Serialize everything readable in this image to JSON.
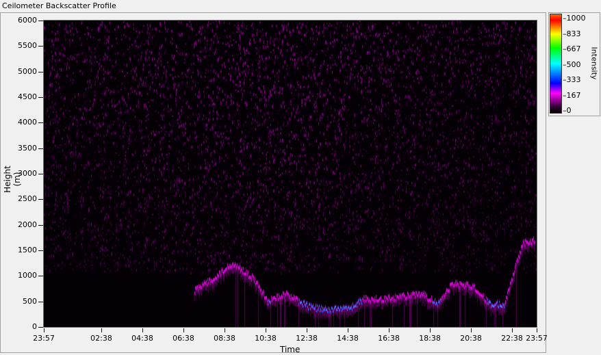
{
  "window_title": "Ceilometer Backscatter Profile",
  "chart_data": {
    "type": "heatmap",
    "title": "Ceilometer Backscatter Profile",
    "xlabel": "Time",
    "ylabel": "Height (m)",
    "ylim": [
      0,
      6000
    ],
    "x_ticks": [
      "23:57",
      "02:38",
      "04:38",
      "06:38",
      "08:38",
      "10:38",
      "12:38",
      "14:38",
      "16:38",
      "18:38",
      "20:38",
      "22:38",
      "23:57"
    ],
    "y_ticks": [
      "0",
      "500",
      "1000",
      "1500",
      "2000",
      "2500",
      "3000",
      "3500",
      "4000",
      "4500",
      "5000",
      "5500",
      "6000"
    ],
    "colorbar": {
      "label": "Intensity",
      "ticks": [
        "0",
        "167",
        "333",
        "500",
        "667",
        "833",
        "1000"
      ],
      "range": [
        0,
        1000
      ]
    },
    "colors": {
      "background": "#050005",
      "low": "#ff00ff",
      "mid": "#0000ff",
      "high": "#00ffff"
    },
    "cloud_layer_heights_m": [
      {
        "time_h": 7.3,
        "height": 700
      },
      {
        "time_h": 7.8,
        "height": 850
      },
      {
        "time_h": 8.4,
        "height": 1000
      },
      {
        "time_h": 9.2,
        "height": 1250
      },
      {
        "time_h": 10.2,
        "height": 950
      },
      {
        "time_h": 10.9,
        "height": 500
      },
      {
        "time_h": 11.8,
        "height": 650
      },
      {
        "time_h": 12.9,
        "height": 400
      },
      {
        "time_h": 13.8,
        "height": 330
      },
      {
        "time_h": 14.9,
        "height": 380
      },
      {
        "time_h": 15.6,
        "height": 550
      },
      {
        "time_h": 16.5,
        "height": 550
      },
      {
        "time_h": 17.4,
        "height": 600
      },
      {
        "time_h": 18.4,
        "height": 650
      },
      {
        "time_h": 19.2,
        "height": 450
      },
      {
        "time_h": 19.9,
        "height": 850
      },
      {
        "time_h": 20.9,
        "height": 800
      },
      {
        "time_h": 21.7,
        "height": 450
      },
      {
        "time_h": 22.4,
        "height": 450
      },
      {
        "time_h": 23.3,
        "height": 1650
      },
      {
        "time_h": 23.9,
        "height": 1700
      }
    ]
  }
}
